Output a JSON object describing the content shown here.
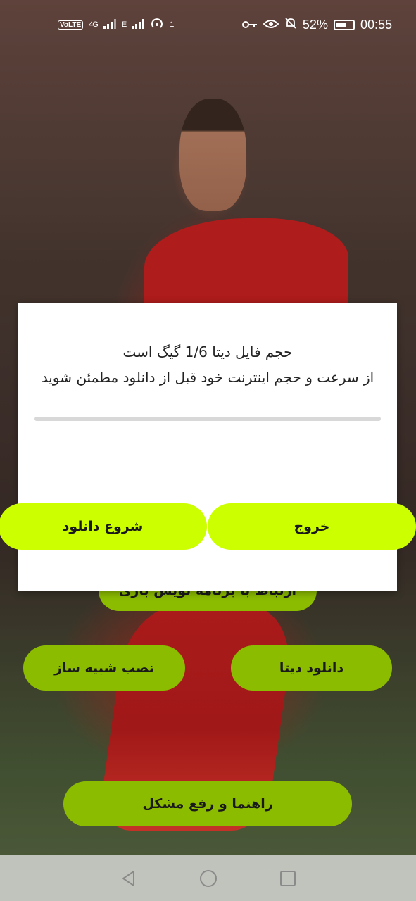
{
  "status_bar": {
    "volte": "VoLTE",
    "network": "4G",
    "network_type": "E",
    "hotspot_count": "1",
    "battery_percent": "52%",
    "time": "00:55"
  },
  "dialog": {
    "line1": "حجم فایل دیتا 1/6 گیگ است",
    "line2": "از سرعت و حجم اینترنت خود قبل از دانلود مطمئن شوید",
    "progress": 0,
    "start_label": "شروع دانلود",
    "exit_label": "خروج"
  },
  "main": {
    "connect_label": "ارتباط با برنامه نویس بازی",
    "emulator_label": "نصب شبیه ساز",
    "data_label": "دانلود دیتا",
    "help_label": "راهنما و رفع مشکل"
  },
  "colors": {
    "dialog_button": "#ccff00",
    "main_button": "#8cbc00",
    "progress_track": "#d8d8d8"
  },
  "icons": [
    "key-icon",
    "eye-icon",
    "bell-off-icon",
    "battery-icon",
    "back-icon",
    "home-icon",
    "recents-icon"
  ]
}
